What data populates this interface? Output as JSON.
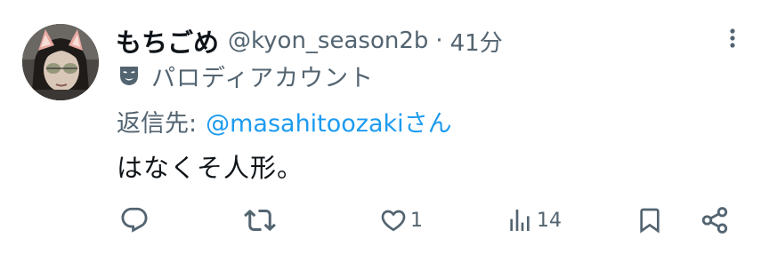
{
  "post": {
    "display_name": "もちごめ",
    "handle": "@kyon_season2b",
    "separator": "·",
    "time": "41分",
    "account_label": "パロディアカウント",
    "reply_prefix": "返信先:",
    "reply_target": "@masahitoozakiさん",
    "text": "はなくそ人形。"
  },
  "actions": {
    "reply_count": "",
    "repost_count": "",
    "like_count": "1",
    "views_count": "14"
  },
  "icons": [
    "more-icon",
    "parody-mask-icon",
    "reply-icon",
    "repost-icon",
    "like-icon",
    "views-icon",
    "bookmark-icon",
    "share-icon"
  ],
  "colors": {
    "text": "#0f1419",
    "secondary": "#536471",
    "link": "#1d9bf0"
  }
}
